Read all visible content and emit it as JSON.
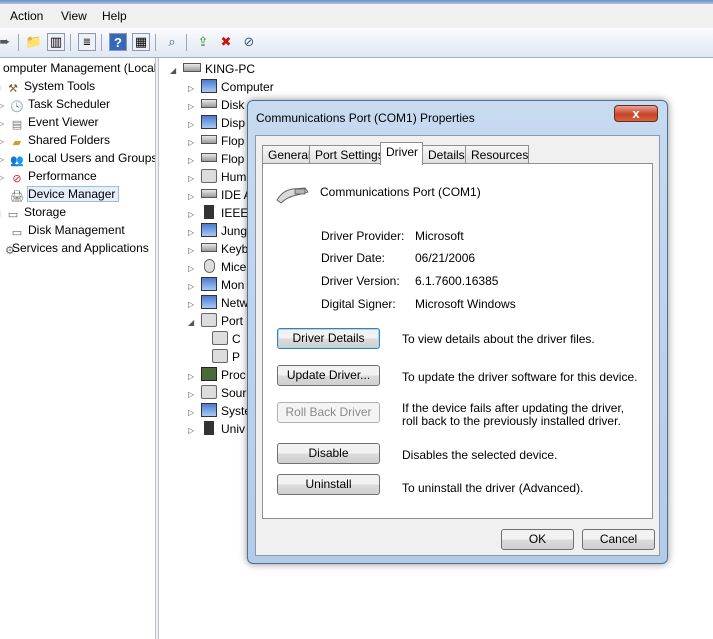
{
  "menu": {
    "items": [
      "Action",
      "View",
      "Help"
    ]
  },
  "toolbar": {
    "icons": [
      "back-arrow-icon",
      "folder-up-icon",
      "show-hide-tree-icon",
      "properties-icon",
      "help-icon",
      "show-hide-action-icon",
      "scan-hardware-icon",
      "update-driver-icon",
      "uninstall-icon",
      "disable-icon"
    ]
  },
  "left_tree": {
    "items": [
      {
        "label": "omputer Management (Local"
      },
      {
        "label": "System Tools"
      },
      {
        "label": "Task Scheduler"
      },
      {
        "label": "Event Viewer"
      },
      {
        "label": "Shared Folders"
      },
      {
        "label": "Local Users and Groups"
      },
      {
        "label": "Performance"
      },
      {
        "label": "Device Manager"
      },
      {
        "label": "Storage"
      },
      {
        "label": "Disk Management"
      },
      {
        "label": "Services and Applications"
      }
    ]
  },
  "device_tree": {
    "root": "KING-PC",
    "items": [
      {
        "label": "Computer"
      },
      {
        "label": "Disk dr"
      },
      {
        "label": "Disp"
      },
      {
        "label": "Flop"
      },
      {
        "label": "Flop"
      },
      {
        "label": "Hum"
      },
      {
        "label": "IDE A"
      },
      {
        "label": "IEEE"
      },
      {
        "label": "Jung"
      },
      {
        "label": "Keyb"
      },
      {
        "label": "Mice"
      },
      {
        "label": "Mon"
      },
      {
        "label": "Netw"
      },
      {
        "label": "Port"
      },
      {
        "label": "C"
      },
      {
        "label": "P"
      },
      {
        "label": "Proc"
      },
      {
        "label": "Sour"
      },
      {
        "label": "Syste"
      },
      {
        "label": "Univ"
      }
    ]
  },
  "dialog": {
    "title": "Communications Port (COM1) Properties",
    "close": "x",
    "tabs": [
      "General",
      "Port Settings",
      "Driver",
      "Details",
      "Resources"
    ],
    "device_name": "Communications Port (COM1)",
    "fields": [
      {
        "label": "Driver Provider:",
        "value": "Microsoft"
      },
      {
        "label": "Driver Date:",
        "value": "06/21/2006"
      },
      {
        "label": "Driver Version:",
        "value": "6.1.7600.16385"
      },
      {
        "label": "Digital Signer:",
        "value": "Microsoft Windows"
      }
    ],
    "actions": [
      {
        "button": "Driver Details",
        "description": "To view details about the driver files."
      },
      {
        "button": "Update Driver...",
        "description": "To update the driver software for this device."
      },
      {
        "button": "Roll Back Driver",
        "description": "If the device fails after updating the driver, roll back to the previously installed driver."
      },
      {
        "button": "Disable",
        "description": "Disables the selected device."
      },
      {
        "button": "Uninstall",
        "description": "To uninstall the driver (Advanced)."
      }
    ],
    "ok": "OK",
    "cancel": "Cancel"
  },
  "colors": {
    "accent": "#3c7fb1",
    "close_red": "#c7432a",
    "dialog_frame": "#b4cbe8"
  }
}
